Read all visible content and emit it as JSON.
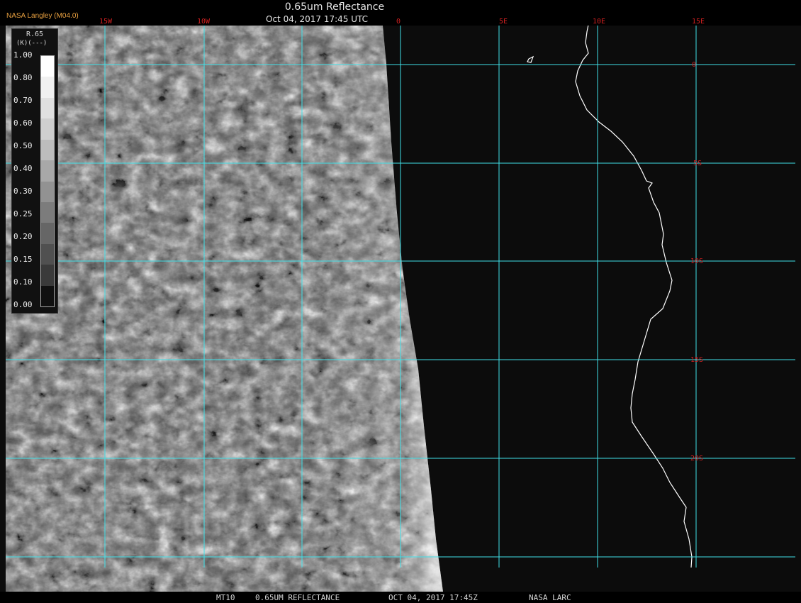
{
  "header": {
    "org_label": "NASA Langley (M04.0)",
    "title": "0.65um Reflectance",
    "subtitle": "Oct 04, 2017 17:45 UTC"
  },
  "legend": {
    "title": "R.65",
    "unit": "(K)(---)",
    "ticks": [
      "1.00",
      "0.80",
      "0.70",
      "0.60",
      "0.50",
      "0.40",
      "0.30",
      "0.25",
      "0.20",
      "0.15",
      "0.10",
      "0.00"
    ]
  },
  "map": {
    "lon_labels": [
      "15W",
      "10W",
      "0",
      "5E",
      "10E",
      "15E"
    ],
    "lat_labels": [
      "0",
      "5S",
      "10S",
      "15S",
      "20S"
    ],
    "grid_color": "#40e0e8",
    "label_color": "#d02020"
  },
  "footer": {
    "satellite": "MT10",
    "product": "0.65UM REFLECTANCE",
    "datetime": "OCT 04, 2017 17:45Z",
    "source": "NASA LARC"
  }
}
